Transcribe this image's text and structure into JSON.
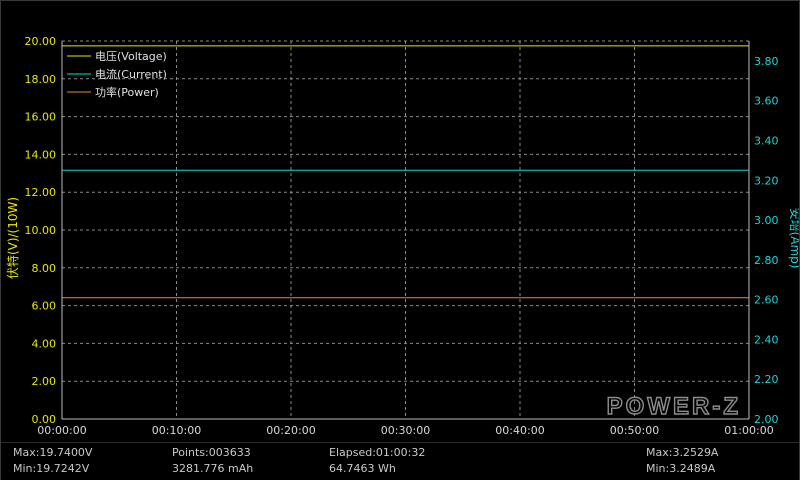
{
  "colors": {
    "voltage": "#e6e600",
    "current": "#19d6d6",
    "power": "#f08a24",
    "grid": "#8a8a8a",
    "axis": "#bdbdbd",
    "logo": "#8c8c8c"
  },
  "logo_text": "POWER-Z",
  "chart_data": {
    "type": "line",
    "x_ticks": [
      "00:00:00",
      "00:10:00",
      "00:20:00",
      "00:30:00",
      "00:40:00",
      "00:50:00",
      "01:00:00"
    ],
    "xlim": [
      0,
      60
    ],
    "y_left": {
      "label": "伏特(V)/(10W)",
      "ylim": [
        0,
        20
      ],
      "ticks": [
        "0.00",
        "2.00",
        "4.00",
        "6.00",
        "8.00",
        "10.00",
        "12.00",
        "14.00",
        "16.00",
        "18.00",
        "20.00"
      ]
    },
    "y_right": {
      "label": "安培(Amp)",
      "ylim": [
        2.0,
        3.9
      ],
      "ticks": [
        "2.00",
        "2.20",
        "2.40",
        "2.60",
        "2.80",
        "3.00",
        "3.20",
        "3.40",
        "3.60",
        "3.80"
      ]
    },
    "grid": true,
    "legend_position": "top-left",
    "series": [
      {
        "name": "电压(Voltage)",
        "axis": "left",
        "x": [
          0,
          60
        ],
        "values": [
          19.74,
          19.74
        ]
      },
      {
        "name": "电流(Current)",
        "axis": "right",
        "x": [
          0,
          60
        ],
        "values": [
          3.25,
          3.25
        ]
      },
      {
        "name": "功率(Power)",
        "axis": "left",
        "x": [
          0,
          60
        ],
        "values": [
          6.42,
          6.42
        ]
      }
    ]
  },
  "stats": {
    "max_voltage": "Max:19.7400V",
    "min_voltage": "Min:19.7242V",
    "points": "Points:003633",
    "capacity_mah": "3281.776 mAh",
    "elapsed": "Elapsed:01:00:32",
    "energy_wh": "64.7463 Wh",
    "max_current": "Max:3.2529A",
    "min_current": "Min:3.2489A"
  }
}
